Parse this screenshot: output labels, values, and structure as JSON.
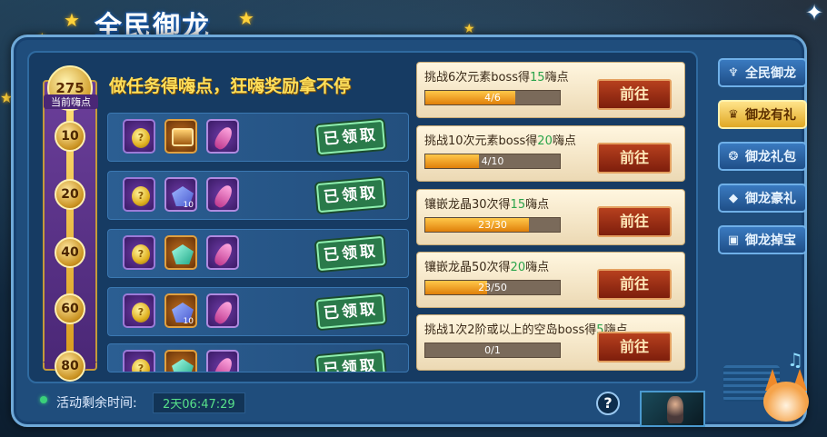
{
  "title": "全民御龙",
  "tagline": "做任务得嗨点，狂嗨奖励拿不停",
  "points": {
    "value": "275",
    "label": "当前嗨点"
  },
  "milestones": [
    "10",
    "20",
    "40",
    "60",
    "80"
  ],
  "reward_rows": [
    {
      "items": [
        {
          "type": "coin",
          "icon": "coin-icon"
        },
        {
          "type": "chest",
          "icon": "treasure-chest-icon"
        },
        {
          "type": "feather",
          "icon": "feather-icon"
        }
      ],
      "claimed_label": "已领取"
    },
    {
      "items": [
        {
          "type": "coin",
          "icon": "coin-icon"
        },
        {
          "type": "gem",
          "icon": "crystal-icon",
          "qty": "10"
        },
        {
          "type": "feather",
          "icon": "feather-icon"
        }
      ],
      "claimed_label": "已领取"
    },
    {
      "items": [
        {
          "type": "coin",
          "icon": "coin-icon"
        },
        {
          "type": "gem-green",
          "icon": "jade-icon"
        },
        {
          "type": "feather",
          "icon": "feather-icon"
        }
      ],
      "claimed_label": "已领取"
    },
    {
      "items": [
        {
          "type": "coin",
          "icon": "coin-icon"
        },
        {
          "type": "gem",
          "icon": "crystal-icon",
          "qty": "10"
        },
        {
          "type": "feather",
          "icon": "feather-icon"
        }
      ],
      "claimed_label": "已领取"
    },
    {
      "items": [
        {
          "type": "coin",
          "icon": "coin-icon"
        },
        {
          "type": "gem-green",
          "icon": "jade-icon"
        },
        {
          "type": "feather",
          "icon": "feather-icon"
        }
      ],
      "claimed_label": "已领取"
    }
  ],
  "tasks": [
    {
      "prefix": "挑战6次元素boss得",
      "points": "15",
      "suffix": "嗨点",
      "progress_text": "4/6",
      "progress": 0.667,
      "button": "前往"
    },
    {
      "prefix": "挑战10次元素boss得",
      "points": "20",
      "suffix": "嗨点",
      "progress_text": "4/10",
      "progress": 0.4,
      "button": "前往"
    },
    {
      "prefix": "镶嵌龙晶30次得",
      "points": "15",
      "suffix": "嗨点",
      "progress_text": "23/30",
      "progress": 0.767,
      "button": "前往"
    },
    {
      "prefix": "镶嵌龙晶50次得",
      "points": "20",
      "suffix": "嗨点",
      "progress_text": "23/50",
      "progress": 0.46,
      "button": "前往"
    },
    {
      "prefix": "挑战1次2阶或以上的空岛boss得",
      "points": "5",
      "suffix": "嗨点",
      "progress_text": "0/1",
      "progress": 0,
      "button": "前往"
    }
  ],
  "side_tabs": [
    {
      "label": "全民御龙",
      "icon": "dragon-icon",
      "glyph": "♆",
      "active": false
    },
    {
      "label": "御龙有礼",
      "icon": "gift-icon",
      "glyph": "♛",
      "active": true
    },
    {
      "label": "御龙礼包",
      "icon": "package-icon",
      "glyph": "❂",
      "active": false
    },
    {
      "label": "御龙豪礼",
      "icon": "diamond-icon",
      "glyph": "◆",
      "active": false
    },
    {
      "label": "御龙掉宝",
      "icon": "loot-icon",
      "glyph": "▣",
      "active": false
    }
  ],
  "footer": {
    "timer_label": "活动剩余时间:",
    "timer_value": "2天06:47:29",
    "help": "?"
  },
  "colors": {
    "accent": "#ffdf5a",
    "highlight": "#2aa44a",
    "button": "#9a2e14",
    "active_tab": "#f0c040"
  }
}
